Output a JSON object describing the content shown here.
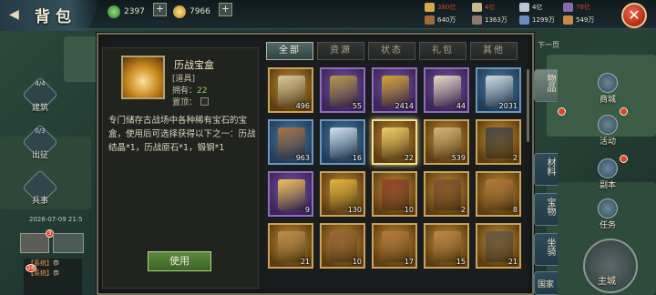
{
  "header": {
    "title": "背包",
    "currency_jade": "2397",
    "currency_gold": "7966",
    "resources": [
      {
        "name": "food",
        "value": "380亿",
        "color": "#e0412a"
      },
      {
        "name": "wood",
        "value": "640万",
        "color": "#e7e2cf"
      },
      {
        "name": "stone",
        "value": "4亿",
        "color": "#e0412a"
      },
      {
        "name": "iron",
        "value": "1363万",
        "color": "#e7e2cf"
      },
      {
        "name": "silver",
        "value": "4亿",
        "color": "#e7e2cf"
      },
      {
        "name": "troops",
        "value": "1299万",
        "color": "#e7e2cf"
      },
      {
        "name": "horse",
        "value": "78亿",
        "color": "#e0412a"
      },
      {
        "name": "copper",
        "value": "549万",
        "color": "#e7e2cf"
      }
    ]
  },
  "left_menu": [
    {
      "label": "建筑",
      "num": "4/4",
      "icon": "building-icon"
    },
    {
      "label": "出征",
      "num": "0/3",
      "icon": "march-icon"
    },
    {
      "label": "兵事",
      "num": "",
      "icon": "military-icon"
    }
  ],
  "left_extra": {
    "timestamp": "2026-07-09 21:5",
    "chat_badge": "3",
    "chat_badge2": "28",
    "chat_lines": [
      {
        "tag": "【系统】",
        "text": "恭"
      },
      {
        "tag": "【系统】",
        "text": "恭"
      }
    ]
  },
  "right_tabs": [
    {
      "label": "物品"
    },
    {
      "label": "材料"
    },
    {
      "label": "宝物"
    },
    {
      "label": "坐骑"
    },
    {
      "label": "国家"
    }
  ],
  "right_menu": [
    {
      "label": "商城",
      "icon": "shop-icon"
    },
    {
      "label": "活动",
      "icon": "event-icon"
    },
    {
      "label": "副本",
      "icon": "dungeon-icon"
    },
    {
      "label": "任务",
      "icon": "quest-icon"
    },
    {
      "label": "主城",
      "icon": "city-icon"
    }
  ],
  "right_extra": {
    "next_page": "下一页"
  },
  "detail": {
    "name": "历战宝盒",
    "type": "[道具]",
    "owned_label": "拥有：",
    "owned_value": "22",
    "pin_label": "置顶：",
    "description": "专门储存古战场中各种稀有宝石的宝盒，使用后可选择获得以下之一：历战结晶*1，历战原石*1，锻钢*1",
    "use_button": "使用"
  },
  "tabs": [
    {
      "label": "全部",
      "active": true
    },
    {
      "label": "资源",
      "active": false
    },
    {
      "label": "状态",
      "active": false
    },
    {
      "label": "礼包",
      "active": false
    },
    {
      "label": "其他",
      "active": false
    }
  ],
  "items": [
    {
      "count": "496",
      "quality": "gold",
      "art": "#d9c9a0",
      "name": "scroll-bundle-icon"
    },
    {
      "count": "55",
      "quality": "purple",
      "art": "#b89a4a",
      "name": "token-icon"
    },
    {
      "count": "2414",
      "quality": "purple",
      "art": "#d8a532",
      "name": "gold-ingot-icon"
    },
    {
      "count": "44",
      "quality": "purple",
      "art": "#e8dcc4",
      "name": "scroll-pouch-icon"
    },
    {
      "count": "2031",
      "quality": "blue",
      "art": "#cfdbe4",
      "name": "silver-ingot-icon"
    },
    {
      "count": "963",
      "quality": "blue",
      "art": "#a77348",
      "name": "leather-icon"
    },
    {
      "count": "16",
      "quality": "blue",
      "art": "#d4e4f2",
      "name": "crystal-icon"
    },
    {
      "count": "22",
      "quality": "gold",
      "art": "#f0cf6c",
      "name": "treasure-box-icon",
      "selected": true
    },
    {
      "count": "539",
      "quality": "gold",
      "art": "#d7b57a",
      "name": "stone-block-icon"
    },
    {
      "count": "2",
      "quality": "gold",
      "art": "#4a4a48",
      "name": "ore-icon"
    },
    {
      "count": "9",
      "quality": "purple",
      "art": "#f0c45a",
      "name": "gem-crystal-icon"
    },
    {
      "count": "130",
      "quality": "gold",
      "art": "#e6b540",
      "name": "gold-ore-icon"
    },
    {
      "count": "10",
      "quality": "gold",
      "art": "#9a4530",
      "name": "banner-icon"
    },
    {
      "count": "2",
      "quality": "gold",
      "art": "#8a5530",
      "name": "armor-icon"
    },
    {
      "count": "8",
      "quality": "gold",
      "art": "#b57a3e",
      "name": "scroll-book-icon"
    },
    {
      "count": "21",
      "quality": "gold",
      "art": "#c09050",
      "name": "tablet-icon"
    },
    {
      "count": "10",
      "quality": "gold",
      "art": "#a06838",
      "name": "book-icon"
    },
    {
      "count": "17",
      "quality": "gold",
      "art": "#b87a40",
      "name": "manual-icon"
    },
    {
      "count": "15",
      "quality": "gold",
      "art": "#c08a48",
      "name": "letter-icon"
    },
    {
      "count": "21",
      "quality": "gold",
      "art": "#6a5a48",
      "name": "sword-icon"
    }
  ]
}
